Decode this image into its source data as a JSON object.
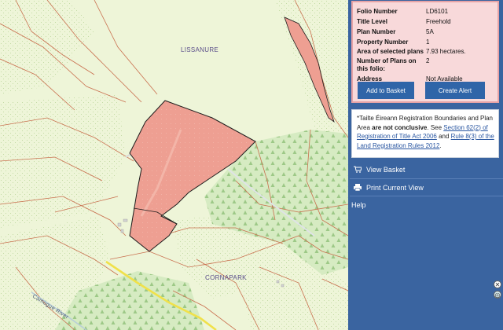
{
  "map": {
    "place_labels": [
      "LISSANURE",
      "CORNAPARK"
    ],
    "river_label": "Camogue River",
    "colors": {
      "background": "#eef5d8",
      "forest": "#d9ebc3",
      "field_line": "#c9704f",
      "parcel_fill": "#ee9f92",
      "road": "#f0e14a"
    }
  },
  "folio": {
    "rows": [
      {
        "key": "Folio Number",
        "value": "LD6101"
      },
      {
        "key": "Title Level",
        "value": "Freehold"
      },
      {
        "key": "Plan Number",
        "value": "5A"
      },
      {
        "key": "Property Number",
        "value": "1"
      },
      {
        "key": "Area of selected plans",
        "value": "7.93 hectares."
      },
      {
        "key": "Number of Plans on this folio:",
        "value": "2"
      },
      {
        "key": "Address",
        "value": "Not Available"
      }
    ],
    "add_to_basket": "Add to Basket",
    "create_alert": "Create Alert"
  },
  "notice": {
    "prefix": "*Tailte Éireann Registration Boundaries and Plan Area ",
    "bold": "are not conclusive",
    "mid1": ". See ",
    "link1": "Section 62(2) of Registration of Title Act 2006",
    "mid2": " and ",
    "link2": "Rule 8(3) of the Land Registration Rules 2012",
    "suffix": "."
  },
  "menu": {
    "view_basket": "View Basket",
    "print_view": "Print Current View",
    "help": "Help"
  },
  "icons": {
    "basket": "shopping-cart-icon",
    "print": "printer-icon",
    "zoom_close": "close-icon",
    "zoom_target": "target-icon"
  }
}
